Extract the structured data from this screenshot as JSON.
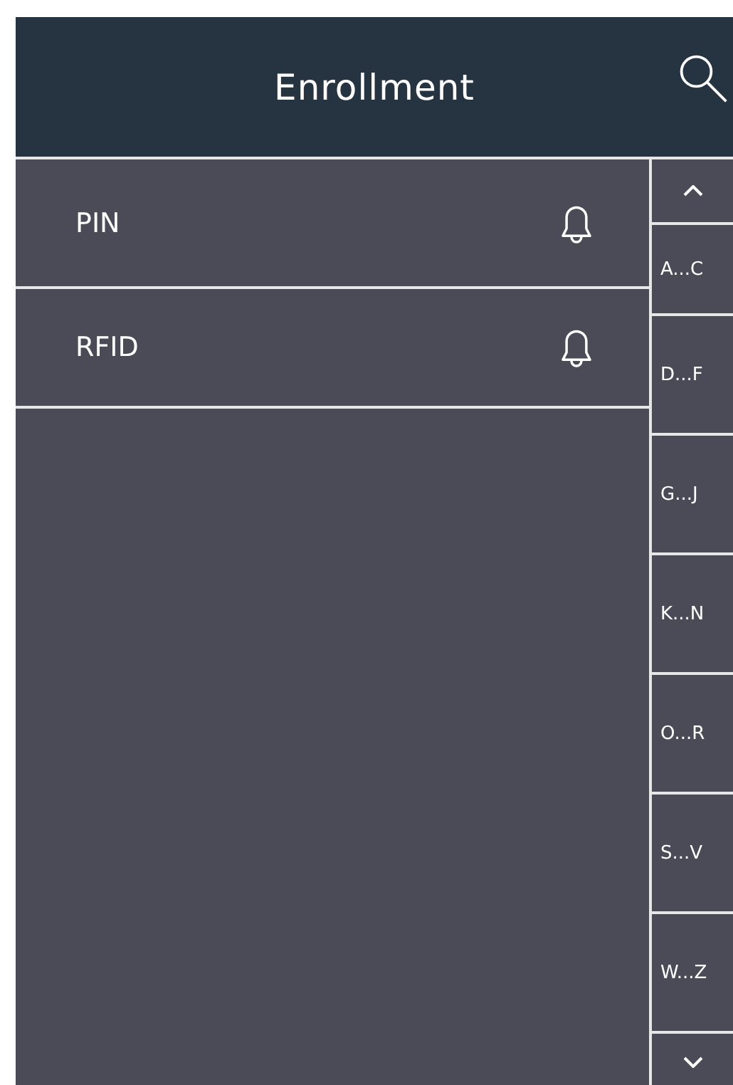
{
  "header": {
    "title": "Enrollment"
  },
  "items": [
    {
      "label": "PIN"
    },
    {
      "label": "RFID"
    }
  ],
  "index": [
    "A...C",
    "D...F",
    "G...J",
    "K...N",
    "O...R",
    "S...V",
    "W...Z"
  ]
}
